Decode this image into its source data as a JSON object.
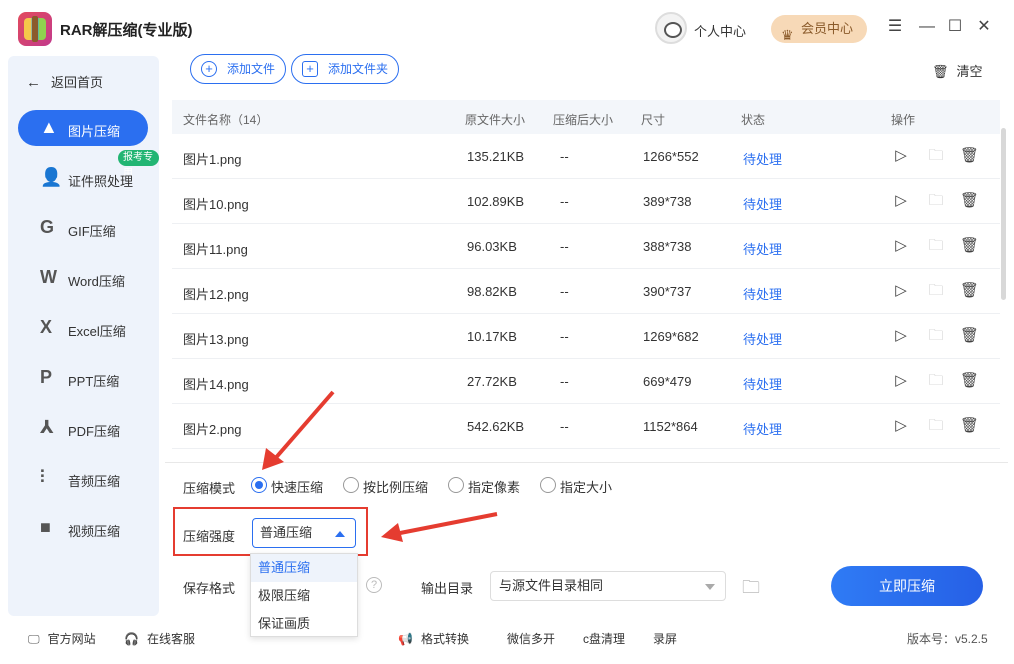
{
  "app": {
    "title": "RAR解压缩(专业版)",
    "user_center": "个人中心",
    "vip": "会员中心"
  },
  "sidebar": {
    "back": "返回首页",
    "badge": "报考专用",
    "items": [
      {
        "label": "图片压缩",
        "icon": "image-icon"
      },
      {
        "label": "证件照处理",
        "icon": "id-photo-icon"
      },
      {
        "label": "GIF压缩",
        "icon": "gif-icon"
      },
      {
        "label": "Word压缩",
        "icon": "word-icon"
      },
      {
        "label": "Excel压缩",
        "icon": "excel-icon"
      },
      {
        "label": "PPT压缩",
        "icon": "ppt-icon"
      },
      {
        "label": "PDF压缩",
        "icon": "pdf-icon"
      },
      {
        "label": "音频压缩",
        "icon": "audio-icon"
      },
      {
        "label": "视频压缩",
        "icon": "video-icon"
      }
    ]
  },
  "toolbar": {
    "add_file": "添加文件",
    "add_folder": "添加文件夹",
    "clear": "清空"
  },
  "table": {
    "headers": {
      "name": "文件名称（14）",
      "orig_size": "原文件大小",
      "comp_size": "压缩后大小",
      "dims": "尺寸",
      "status": "状态",
      "ops": "操作"
    },
    "rows": [
      {
        "name": "图片1.png",
        "orig": "135.21KB",
        "comp": "--",
        "dims": "1266*552",
        "status": "待处理"
      },
      {
        "name": "图片10.png",
        "orig": "102.89KB",
        "comp": "--",
        "dims": "389*738",
        "status": "待处理"
      },
      {
        "name": "图片11.png",
        "orig": "96.03KB",
        "comp": "--",
        "dims": "388*738",
        "status": "待处理"
      },
      {
        "name": "图片12.png",
        "orig": "98.82KB",
        "comp": "--",
        "dims": "390*737",
        "status": "待处理"
      },
      {
        "name": "图片13.png",
        "orig": "10.17KB",
        "comp": "--",
        "dims": "1269*682",
        "status": "待处理"
      },
      {
        "name": "图片14.png",
        "orig": "27.72KB",
        "comp": "--",
        "dims": "669*479",
        "status": "待处理"
      },
      {
        "name": "图片2.png",
        "orig": "542.62KB",
        "comp": "--",
        "dims": "1152*864",
        "status": "待处理"
      }
    ]
  },
  "settings": {
    "mode_label": "压缩模式",
    "modes": [
      "快速压缩",
      "按比例压缩",
      "指定像素",
      "指定大小"
    ],
    "strength_label": "压缩强度",
    "strength_value": "普通压缩",
    "strength_options": [
      "普通压缩",
      "极限压缩",
      "保证画质"
    ],
    "format_label": "保存格式",
    "output_label": "输出目录",
    "output_value": "与源文件目录相同",
    "start": "立即压缩"
  },
  "footer": {
    "website": "官方网站",
    "service": "在线客服",
    "format": "格式转换",
    "wechat": "微信多开",
    "cdisk": "c盘清理",
    "record": "录屏",
    "version": "版本号：v5.2.5"
  },
  "colors": {
    "accent": "#2b6ff0",
    "annotation": "#e53c30",
    "badge": "#22b573",
    "vip": "#f7d9b7"
  }
}
